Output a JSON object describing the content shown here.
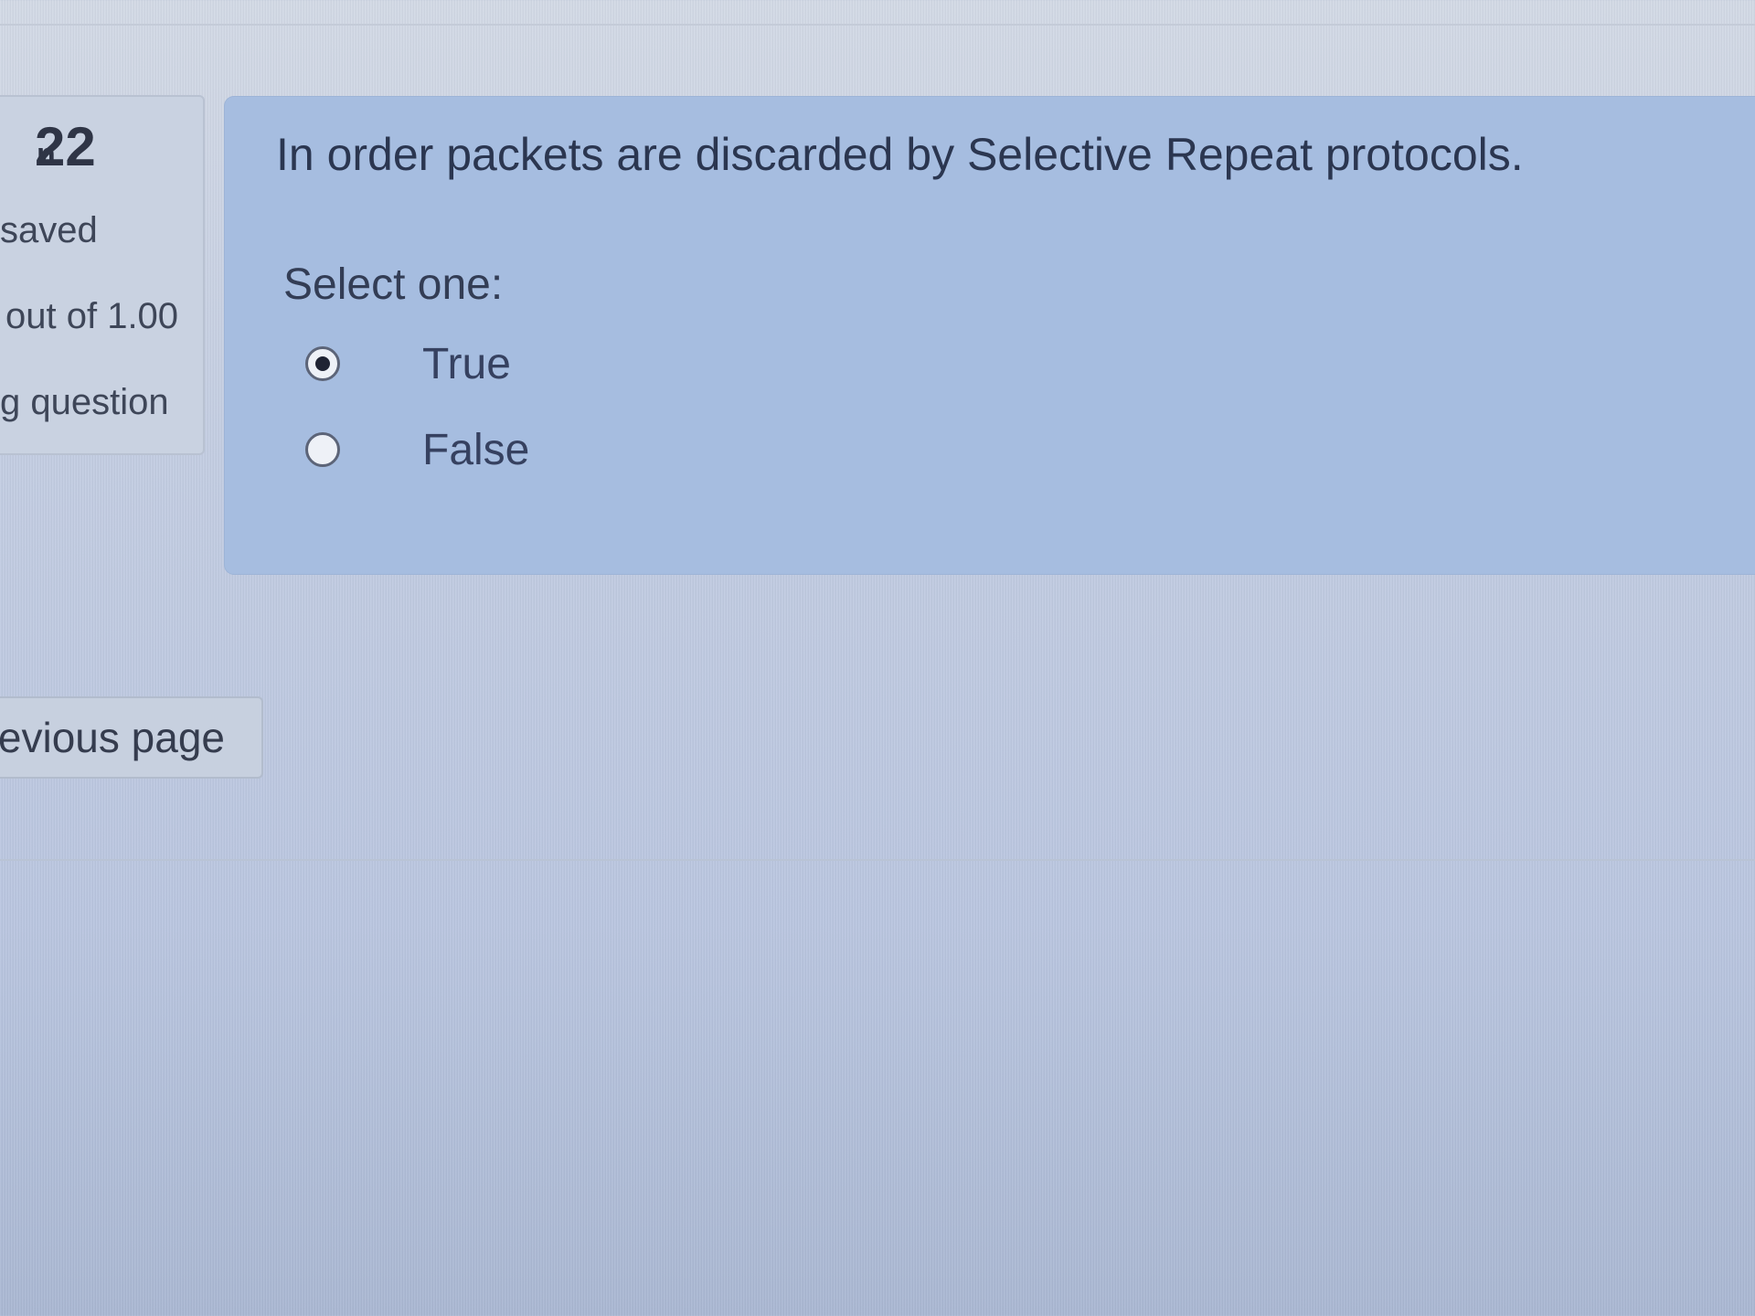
{
  "info": {
    "question_label": "n",
    "question_number": "22",
    "status": "saved",
    "mark": "out of 1.00",
    "flag": "g question"
  },
  "question": {
    "text": "In order packets are discarded by Selective Repeat protocols.",
    "prompt": "Select one:",
    "options": [
      {
        "label": "True",
        "selected": true
      },
      {
        "label": "False",
        "selected": false
      }
    ]
  },
  "navigation": {
    "previous_label": "evious page"
  }
}
